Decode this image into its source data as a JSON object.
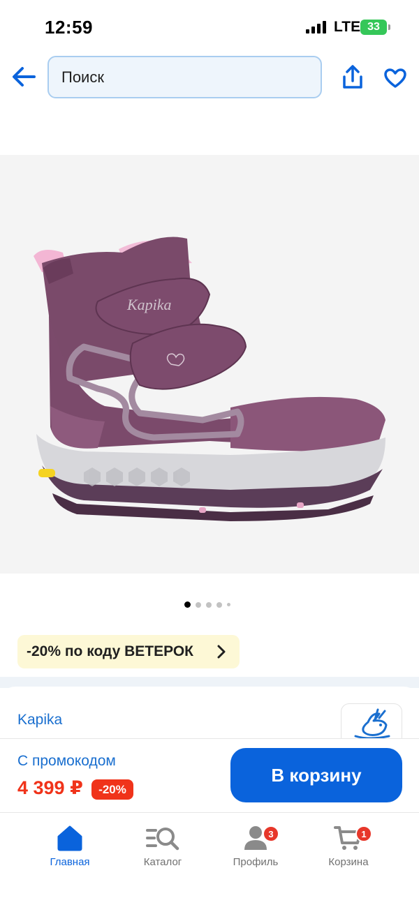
{
  "status_bar": {
    "time": "12:59",
    "network": "LTE",
    "battery": "33"
  },
  "header": {
    "search_placeholder": "Поиск",
    "back_icon": "arrow-left-icon",
    "share_icon": "share-icon",
    "favorite_icon": "heart-icon"
  },
  "product": {
    "image_alt": "Kapika boots",
    "gallery": {
      "total": 5,
      "active_index": 0
    },
    "promo": "-20% по коду ВЕТЕРОК",
    "brand": "Kapika",
    "promo_price_label": "С промокодом",
    "price": "4 399 ₽",
    "discount": "-20%",
    "cart_button": "В корзину"
  },
  "nav": {
    "items": [
      {
        "label": "Главная",
        "icon": "home-icon",
        "active": true
      },
      {
        "label": "Каталог",
        "icon": "catalog-search-icon",
        "active": false
      },
      {
        "label": "Профиль",
        "icon": "profile-icon",
        "badge": "3"
      },
      {
        "label": "Корзина",
        "icon": "cart-icon",
        "badge": "1"
      }
    ]
  },
  "colors": {
    "accent": "#0a63dc",
    "price": "#f0331a",
    "promo_bg": "#fdf8d6",
    "link": "#1a6fcf"
  }
}
